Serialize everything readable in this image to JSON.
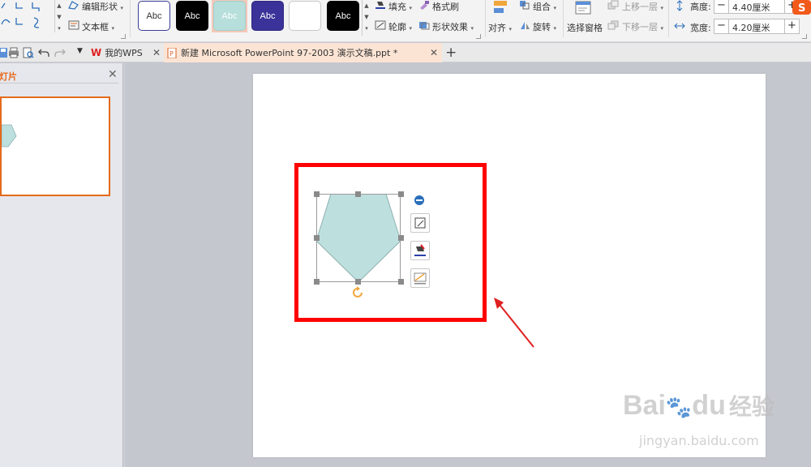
{
  "ribbon": {
    "edit_shape": "编辑形状",
    "text_box": "文本框",
    "styles": [
      {
        "label": "Abc",
        "bg": "#ffffff",
        "fg": "#333333",
        "border": "#3b3f9a"
      },
      {
        "label": "Abc",
        "bg": "#000000",
        "fg": "#ffffff",
        "border": "#000000"
      },
      {
        "label": "Abc",
        "bg": "#b6dedb",
        "fg": "#ffffff",
        "border": "#9fd0cc"
      },
      {
        "label": "Abc",
        "bg": "#3b3399",
        "fg": "#ffffff",
        "border": "#2e2780"
      },
      {
        "label": "",
        "bg": "#ffffff",
        "fg": "#333333",
        "border": "#c8c8c8"
      },
      {
        "label": "Abc",
        "bg": "#000000",
        "fg": "#ffffff",
        "border": "#000000"
      }
    ],
    "fill": "填充",
    "outline": "轮廓",
    "format_painter": "格式刷",
    "shape_effects": "形状效果",
    "align": "对齐",
    "group": "组合",
    "rotate": "旋转",
    "selection_pane": "选择窗格",
    "bring_forward": "上移一层",
    "send_backward": "下移一层",
    "height_label": "高度:",
    "height_value": "4.40厘米",
    "width_label": "宽度:",
    "width_value": "4.20厘米"
  },
  "tabs": {
    "my_wps": "我的WPS",
    "document": "新建 Microsoft PowerPoint 97-2003 演示文稿.ppt *"
  },
  "panel": {
    "title": "幻灯片"
  },
  "shape": {
    "fill": "#bde0df",
    "stroke": "#8fb0b0"
  },
  "colors": {
    "accent": "#e46a1c",
    "highlight": "#ff0000",
    "arrow": "#e02020"
  },
  "watermark": {
    "brand": "Bai",
    "brand2": "du",
    "brand_cn": "经验",
    "url": "jingyan.baidu.com"
  }
}
